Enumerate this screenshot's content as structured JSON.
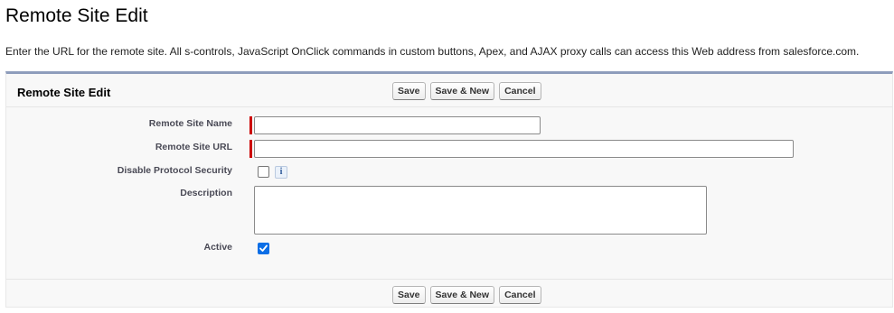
{
  "page": {
    "title": "Remote Site Edit",
    "description": "Enter the URL for the remote site. All s-controls, JavaScript OnClick commands in custom buttons, Apex, and AJAX proxy calls can access this Web address from salesforce.com."
  },
  "block": {
    "title": "Remote Site Edit",
    "buttons": {
      "save": "Save",
      "save_new": "Save & New",
      "cancel": "Cancel"
    }
  },
  "fields": {
    "name": {
      "label": "Remote Site Name",
      "value": "",
      "required": true
    },
    "url": {
      "label": "Remote Site URL",
      "value": "",
      "required": true
    },
    "disable_protocol_security": {
      "label": "Disable Protocol Security",
      "checked": false,
      "info_icon": "i"
    },
    "description": {
      "label": "Description",
      "value": ""
    },
    "active": {
      "label": "Active",
      "checked": true
    }
  },
  "colors": {
    "required": "#cc0000",
    "block_border": "#8e9dbb",
    "checkbox_checked": "#0b6ee6"
  }
}
